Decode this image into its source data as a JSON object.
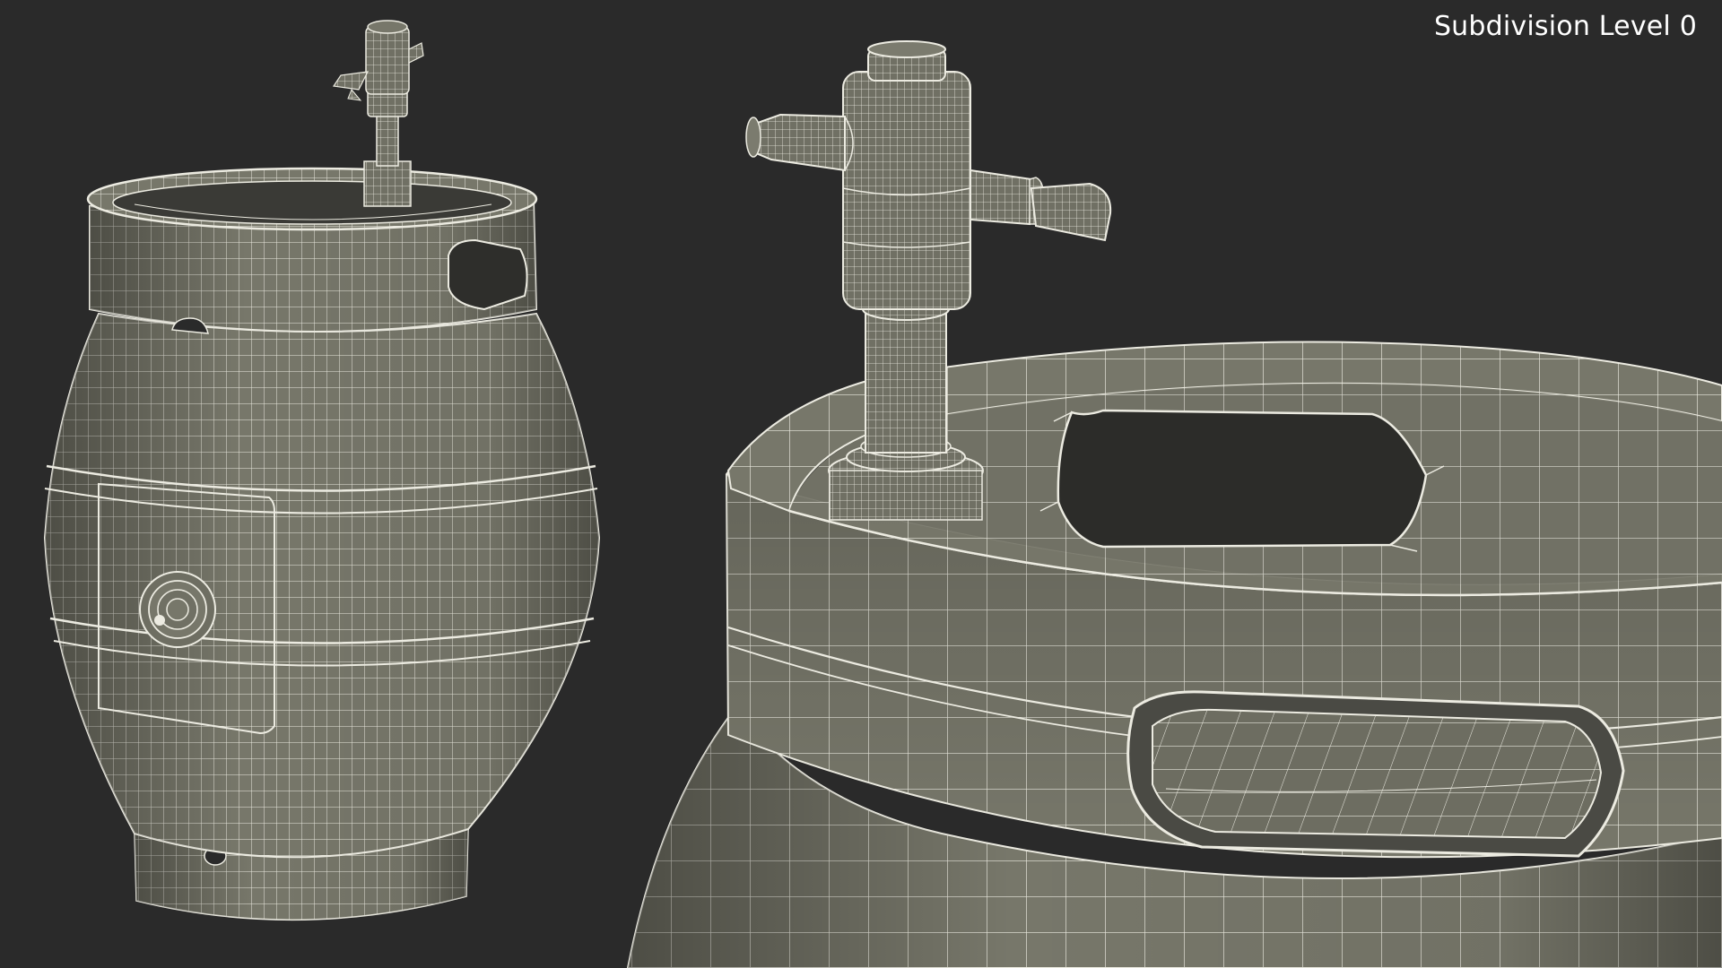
{
  "viewport": {
    "label": "Subdivision Level 0",
    "background_color": "#2a2a2a",
    "mesh_fill_color": "#77776a",
    "wire_color": "#f2f0e6"
  },
  "models": [
    {
      "name": "keg-full-view"
    },
    {
      "name": "keg-closeup-view"
    }
  ]
}
